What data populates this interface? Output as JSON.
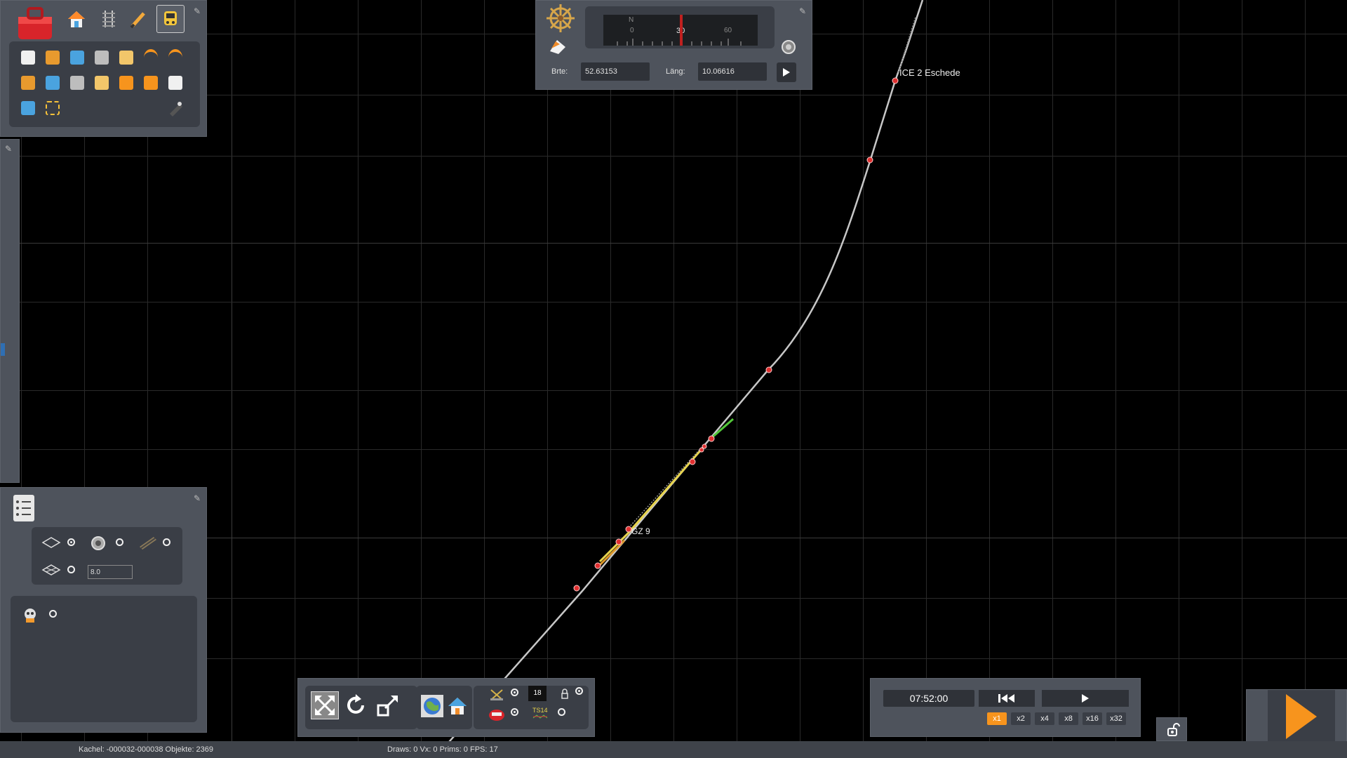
{
  "map": {
    "labels": {
      "station_1": "ICE 2 Eschede",
      "station_2": "GZ 9"
    }
  },
  "navigation": {
    "compass": {
      "ticks": [
        "N",
        "0",
        "30",
        "60"
      ]
    },
    "latitude_label": "Brte:",
    "latitude_value": "52.63153",
    "longitude_label": "Läng:",
    "longitude_value": "10.06616"
  },
  "toolbox": {
    "top_icons": [
      "toolbox-icon",
      "home-icon",
      "track-icon",
      "brush-icon",
      "train-icon"
    ],
    "rows": [
      [
        "copy-icon",
        "paste-icon",
        "monitor-icon",
        "trash-icon",
        "landscape-icon",
        "undo-icon",
        "redo-icon"
      ],
      [
        "timetable-icon",
        "driver-icon",
        "pointer-icon",
        "people-icon",
        "edit-icon",
        "add-signal-icon",
        "settings-icon"
      ],
      [
        "pie-chart-icon",
        "select-rect-icon"
      ]
    ]
  },
  "properties_panel": {
    "height_value": "8.0"
  },
  "playback": {
    "time": "07:52:00",
    "speeds": [
      "x1",
      "x2",
      "x4",
      "x8",
      "x16",
      "x32"
    ],
    "active_speed": "x1"
  },
  "bottom_toolbar": {
    "counter": "18",
    "ts_label": "TS14"
  },
  "status_bar": {
    "tile_info": "Kachel: -000032-000038  Objekte: 2369",
    "render_info": "Draws: 0 Vx: 0 Prims: 0 FPS: 17"
  },
  "colors": {
    "accent": "#f7941d",
    "panel": "#4e535c",
    "track": "#b0b0b0",
    "node": "#e03030"
  }
}
